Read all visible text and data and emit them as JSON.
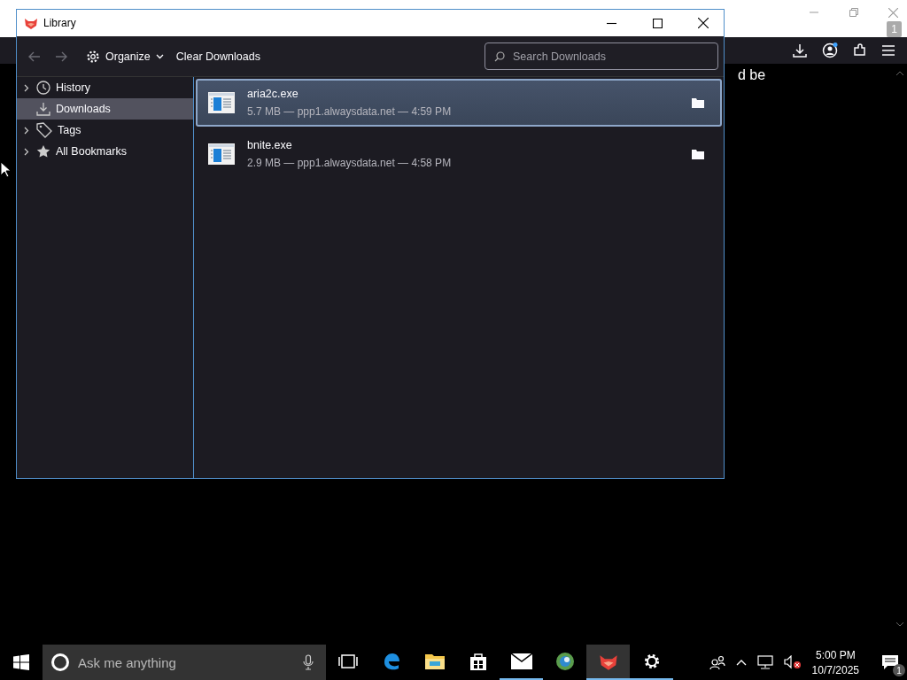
{
  "browser": {
    "page_text": "d be",
    "tab_count": "1"
  },
  "library": {
    "title": "Library",
    "toolbar": {
      "back_disabled": true,
      "forward_disabled": true,
      "organize": "Organize",
      "clear": "Clear Downloads",
      "search_placeholder": "Search Downloads"
    },
    "sidebar": {
      "items": [
        {
          "label": "History",
          "kind": "clock",
          "expandable": true,
          "selected": false
        },
        {
          "label": "Downloads",
          "kind": "download",
          "expandable": false,
          "selected": true
        },
        {
          "label": "Tags",
          "kind": "tag",
          "expandable": true,
          "selected": false
        },
        {
          "label": "All Bookmarks",
          "kind": "star",
          "expandable": true,
          "selected": false
        }
      ]
    },
    "downloads": [
      {
        "name": "aria2c.exe",
        "details": "5.7 MB — ppp1.alwaysdata.net — 4:59 PM",
        "selected": true
      },
      {
        "name": "bnite.exe",
        "details": "2.9 MB — ppp1.alwaysdata.net — 4:58 PM",
        "selected": false
      }
    ]
  },
  "taskbar": {
    "search_placeholder": "Ask me anything",
    "apps": [
      {
        "kind": "taskview",
        "running": false,
        "active": false
      },
      {
        "kind": "edge",
        "running": false,
        "active": false
      },
      {
        "kind": "explorer",
        "running": false,
        "active": false
      },
      {
        "kind": "store",
        "running": false,
        "active": false
      },
      {
        "kind": "mail",
        "running": true,
        "active": false
      },
      {
        "kind": "globe",
        "running": false,
        "active": false
      },
      {
        "kind": "fox",
        "running": true,
        "active": true
      },
      {
        "kind": "settings",
        "running": true,
        "active": false
      }
    ],
    "time": "5:00 PM",
    "date": "10/7/2025",
    "notification_count": "1"
  }
}
